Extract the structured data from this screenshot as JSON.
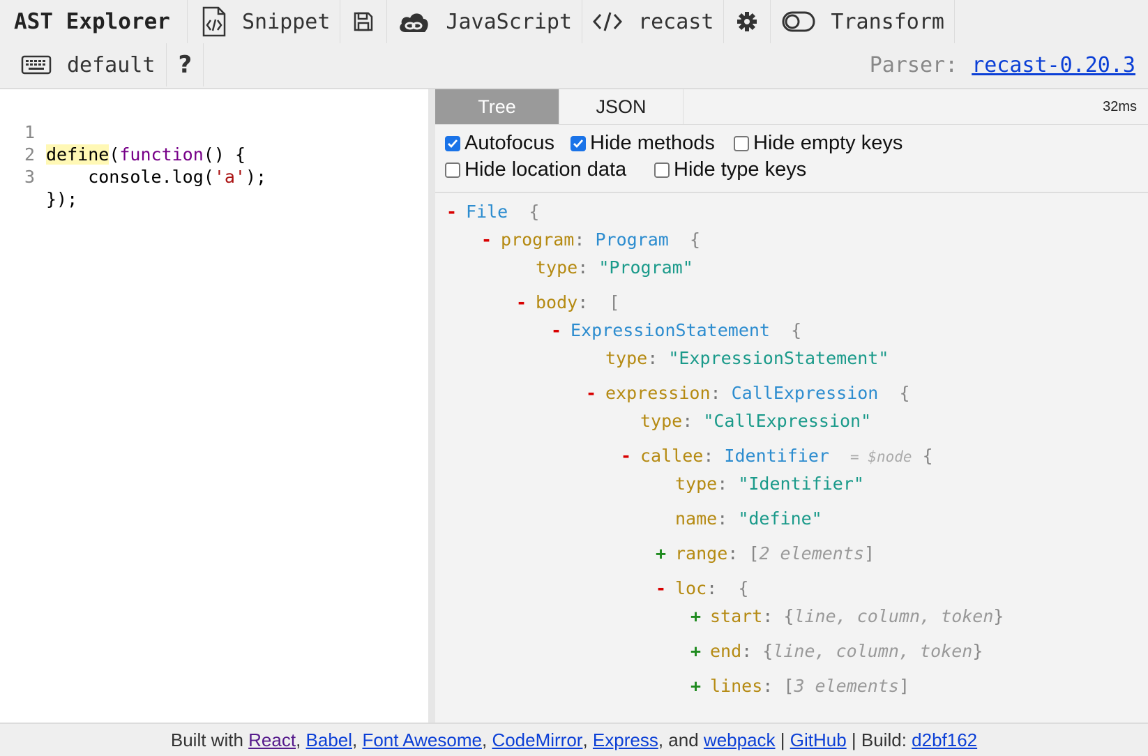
{
  "toolbar": {
    "title": "AST Explorer",
    "snippet_label": "Snippet",
    "language_label": "JavaScript",
    "parser_label": "recast",
    "transform_label": "Transform",
    "keymap_label": "default",
    "help_label": "?",
    "parser_prefix": "Parser:",
    "parser_version": "recast-0.20.3"
  },
  "editor": {
    "lines": [
      {
        "num": "1"
      },
      {
        "num": "2"
      },
      {
        "num": "3"
      }
    ],
    "tokens": {
      "l1_define": "define",
      "l1_paren": "(",
      "l1_function": "function",
      "l1_rest": "() {",
      "l2_indent": "    console.log(",
      "l2_str": "'a'",
      "l2_rest": ");",
      "l3": "});"
    }
  },
  "output": {
    "tabs": [
      "Tree",
      "JSON"
    ],
    "active_tab": "Tree",
    "timing": "32ms",
    "options": [
      {
        "label": "Autofocus",
        "checked": true
      },
      {
        "label": "Hide methods",
        "checked": true
      },
      {
        "label": "Hide empty keys",
        "checked": false
      },
      {
        "label": "Hide location data",
        "checked": false
      },
      {
        "label": "Hide type keys",
        "checked": false
      }
    ],
    "tree": {
      "file": "File",
      "program_key": "program",
      "program_type": "Program",
      "type_key": "type",
      "program_type_str": "\"Program\"",
      "body_key": "body",
      "expr_stmt": "ExpressionStatement",
      "expr_stmt_str": "\"ExpressionStatement\"",
      "expression_key": "expression",
      "call_expr": "CallExpression",
      "call_expr_str": "\"CallExpression\"",
      "callee_key": "callee",
      "identifier": "Identifier",
      "node_ref": "= $node",
      "identifier_str": "\"Identifier\"",
      "name_key": "name",
      "name_str": "\"define\"",
      "range_key": "range",
      "range_meta": "2 elements",
      "loc_key": "loc",
      "start_key": "start",
      "start_meta": "line, column, token",
      "end_key": "end",
      "end_meta": "line, column, token",
      "lines_key": "lines",
      "lines_meta": "3 elements"
    }
  },
  "footer": {
    "built_with": "Built with",
    "links": [
      "React",
      "Babel",
      "Font Awesome",
      "CodeMirror",
      "Express",
      "webpack"
    ],
    "and": "and",
    "github": "GitHub",
    "build_label": "Build:",
    "build_hash": "d2bf162"
  },
  "colors": {
    "accent": "#1a73e8",
    "link": "#0b3fd6",
    "toggle_minus": "#d80000",
    "toggle_plus": "#1e8a1e"
  }
}
